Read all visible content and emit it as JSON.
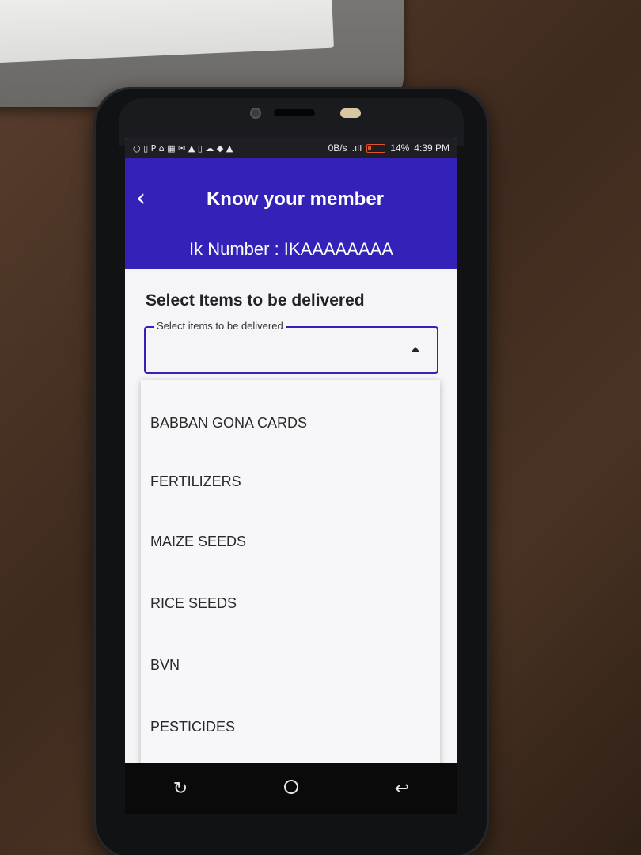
{
  "status_bar": {
    "left_icons": "○ ▯ P ⌂ ▦ ✉ ▲ ▯ ☁ ◆ ▲",
    "network_speed": "0B/s",
    "battery_percent": "14%",
    "time": "4:39 PM"
  },
  "app_bar": {
    "back_icon": "‹",
    "title": "Know your member",
    "ik_number": "Ik Number : IKAAAAAAAA",
    "color": "#3422b8"
  },
  "form": {
    "heading": "Select Items to be delivered",
    "select_label": "Select items to be delivered",
    "select_value": ""
  },
  "dropdown": {
    "options": [
      "BABBAN GONA CARDS",
      "FERTILIZERS",
      "MAIZE SEEDS",
      "RICE SEEDS",
      "BVN",
      "PESTICIDES"
    ]
  },
  "nav_bar": {
    "recent_icon": "↻",
    "back_icon": "↩"
  }
}
